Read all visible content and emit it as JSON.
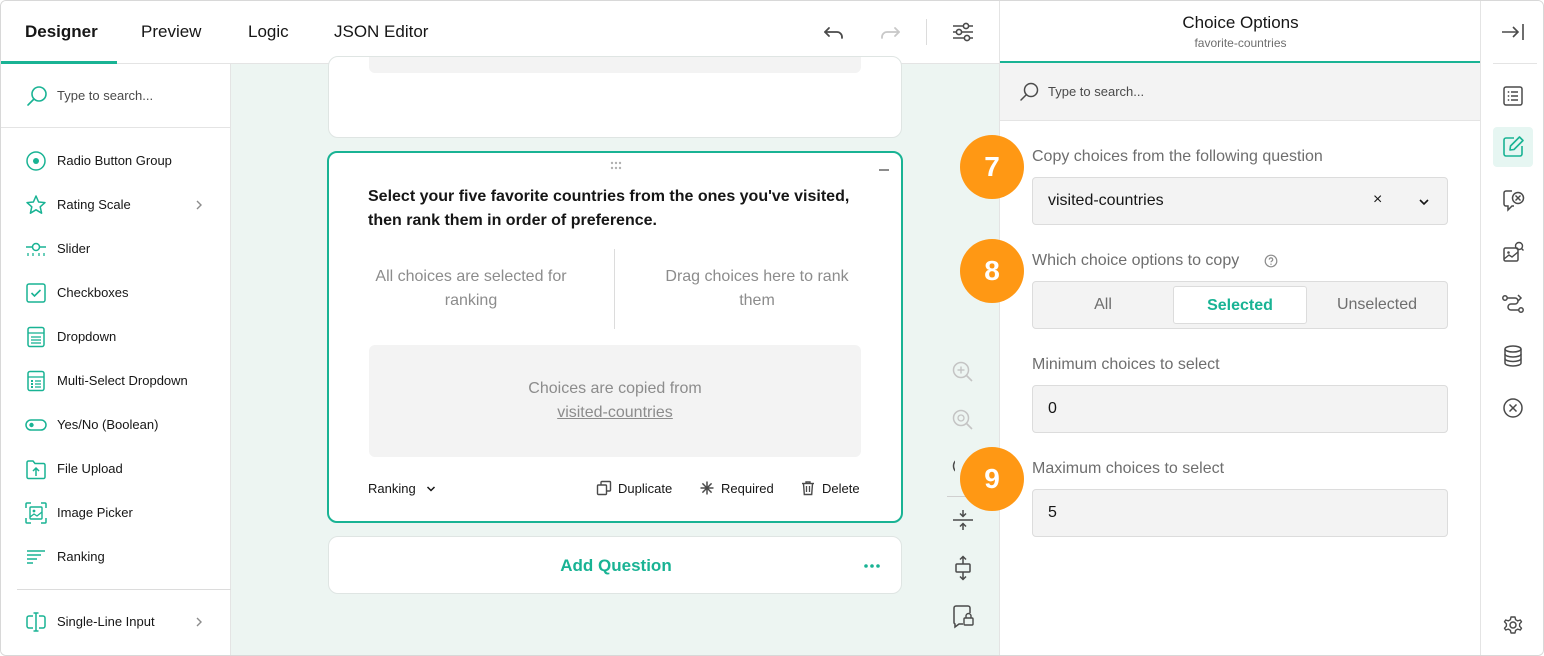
{
  "tabs": [
    {
      "label": "Designer",
      "active": true
    },
    {
      "label": "Preview",
      "active": false
    },
    {
      "label": "Logic",
      "active": false
    },
    {
      "label": "JSON Editor",
      "active": false
    }
  ],
  "toolbox": {
    "search_placeholder": "Type to search...",
    "items": [
      {
        "label": "Radio Button Group",
        "icon": "radio-icon"
      },
      {
        "label": "Rating Scale",
        "icon": "star-icon",
        "has_submenu": true
      },
      {
        "label": "Slider",
        "icon": "slider-icon"
      },
      {
        "label": "Checkboxes",
        "icon": "checkbox-icon"
      },
      {
        "label": "Dropdown",
        "icon": "dropdown-icon"
      },
      {
        "label": "Multi-Select Dropdown",
        "icon": "multi-dropdown-icon"
      },
      {
        "label": "Yes/No (Boolean)",
        "icon": "toggle-icon"
      },
      {
        "label": "File Upload",
        "icon": "file-upload-icon"
      },
      {
        "label": "Image Picker",
        "icon": "image-picker-icon"
      },
      {
        "label": "Ranking",
        "icon": "ranking-icon"
      },
      {
        "label": "Single-Line Input",
        "icon": "text-input-icon",
        "has_submenu": true
      }
    ]
  },
  "question": {
    "title": "Select your five favorite countries from the ones you've visited, then rank them in order of preference.",
    "ranked_placeholder": "All choices are selected for ranking",
    "unranked_placeholder": "Drag choices here to rank them",
    "copied_text": "Choices are copied from",
    "copied_link": "visited-countries",
    "type_label": "Ranking",
    "duplicate_label": "Duplicate",
    "required_label": "Required",
    "delete_label": "Delete"
  },
  "add_question_label": "Add Question",
  "properties": {
    "title": "Choice Options",
    "subtitle": "favorite-countries",
    "search_placeholder": "Type to search...",
    "copy_from_label": "Copy choices from the following question",
    "copy_from_value": "visited-countries",
    "clear_symbol": "×",
    "which_label": "Which choice options to copy",
    "which_options": [
      "All",
      "Selected",
      "Unselected"
    ],
    "which_selected": "Selected",
    "min_label": "Minimum choices to select",
    "min_value": "0",
    "max_label": "Maximum choices to select",
    "max_value": "5"
  },
  "badges": [
    "7",
    "8",
    "9"
  ],
  "colors": {
    "accent": "#19b394",
    "badge": "#ff9814",
    "canvas_bg": "#edf5f2"
  }
}
